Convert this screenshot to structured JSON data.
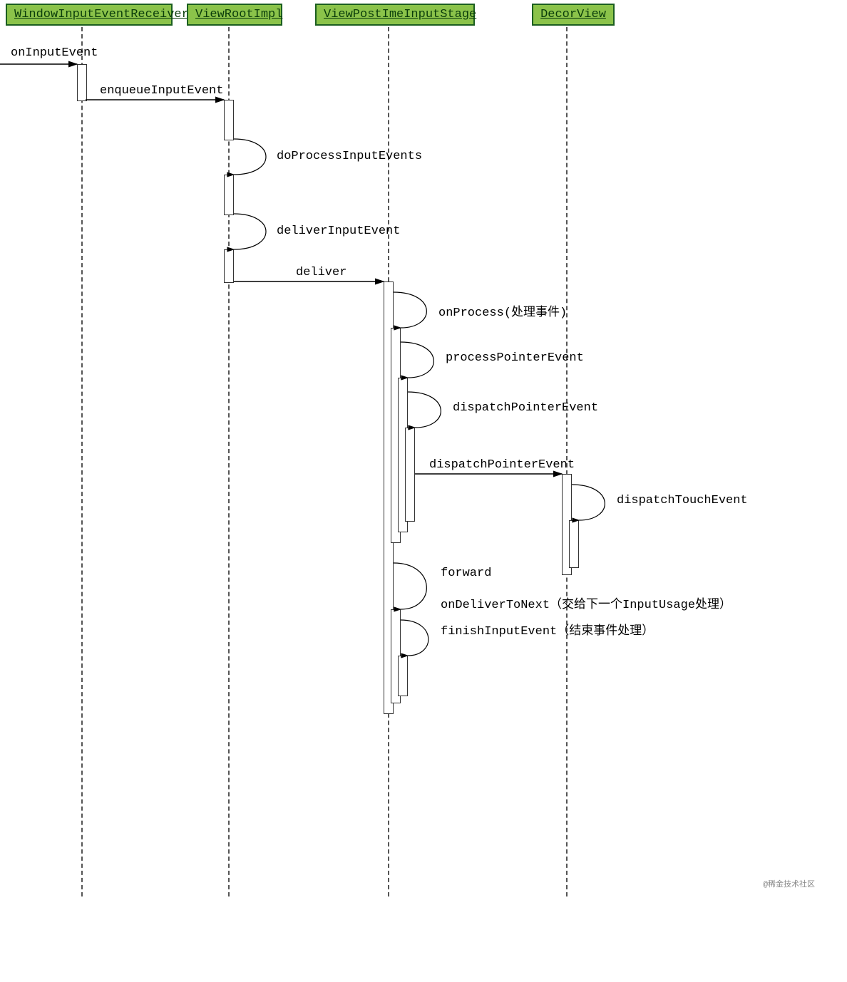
{
  "participants": {
    "p1": "WindowInputEventReceiver",
    "p2": "ViewRootImpl",
    "p3": "ViewPostImeInputStage",
    "p4": "DecorView"
  },
  "messages": {
    "m1": "onInputEvent",
    "m2": "enqueueInputEvent",
    "m3": "doProcessInputEvents",
    "m4": "deliverInputEvent",
    "m5": "deliver",
    "m6": "onProcess(处理事件)",
    "m7": "processPointerEvent",
    "m8": "dispatchPointerEvent",
    "m9": "dispatchPointerEvent",
    "m10": "dispatchTouchEvent",
    "m11": "forward",
    "m12": "onDeliverToNext（交给下一个InputUsage处理）",
    "m13": "finishInputEvent（结束事件处理）"
  },
  "watermark": "@稀金技术社区",
  "chart_data": {
    "type": "sequence_diagram",
    "participants": [
      "WindowInputEventReceiver",
      "ViewRootImpl",
      "ViewPostImeInputStage",
      "DecorView"
    ],
    "messages": [
      {
        "from": "external",
        "to": "WindowInputEventReceiver",
        "label": "onInputEvent"
      },
      {
        "from": "WindowInputEventReceiver",
        "to": "ViewRootImpl",
        "label": "enqueueInputEvent"
      },
      {
        "from": "ViewRootImpl",
        "to": "ViewRootImpl",
        "label": "doProcessInputEvents"
      },
      {
        "from": "ViewRootImpl",
        "to": "ViewRootImpl",
        "label": "deliverInputEvent"
      },
      {
        "from": "ViewRootImpl",
        "to": "ViewPostImeInputStage",
        "label": "deliver"
      },
      {
        "from": "ViewPostImeInputStage",
        "to": "ViewPostImeInputStage",
        "label": "onProcess(处理事件)"
      },
      {
        "from": "ViewPostImeInputStage",
        "to": "ViewPostImeInputStage",
        "label": "processPointerEvent"
      },
      {
        "from": "ViewPostImeInputStage",
        "to": "ViewPostImeInputStage",
        "label": "dispatchPointerEvent"
      },
      {
        "from": "ViewPostImeInputStage",
        "to": "DecorView",
        "label": "dispatchPointerEvent"
      },
      {
        "from": "DecorView",
        "to": "DecorView",
        "label": "dispatchTouchEvent"
      },
      {
        "from": "ViewPostImeInputStage",
        "to": "ViewPostImeInputStage",
        "label": "forward"
      },
      {
        "from": "ViewPostImeInputStage",
        "to": "ViewPostImeInputStage",
        "label": "onDeliverToNext（交给下一个InputUsage处理）"
      },
      {
        "from": "ViewPostImeInputStage",
        "to": "ViewPostImeInputStage",
        "label": "finishInputEvent（结束事件处理）"
      }
    ]
  }
}
